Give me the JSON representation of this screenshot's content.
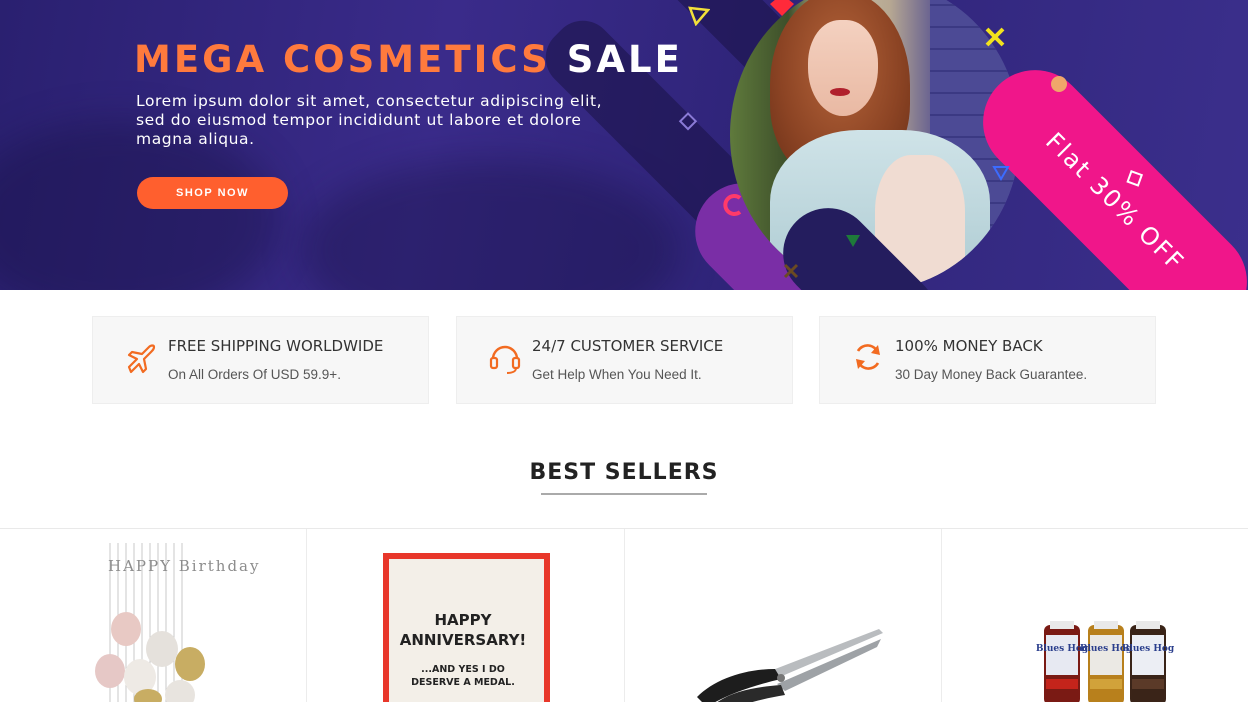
{
  "hero": {
    "title_accent": "MEGA COSMETICS",
    "title_plain": "SALE",
    "description": "Lorem ipsum dolor sit amet, consectetur adipiscing elit, sed do eiusmod tempor incididunt ut labore et dolore magna aliqua.",
    "button_label": "SHOP NOW",
    "promo_text": "Flat 30% OFF",
    "colors": {
      "background": "#2f2479",
      "accent": "#ff7a3d",
      "button": "#ff5f2e",
      "promo": "#f0168a"
    }
  },
  "features": [
    {
      "icon": "airplane-icon",
      "title": "FREE SHIPPING WORLDWIDE",
      "subtitle": "On All Orders Of USD 59.9+."
    },
    {
      "icon": "headset-icon",
      "title": "24/7 CUSTOMER SERVICE",
      "subtitle": "Get Help When You Need It."
    },
    {
      "icon": "refresh-icon",
      "title": "100% MONEY BACK",
      "subtitle": "30 Day Money Back Guarantee."
    }
  ],
  "best_sellers": {
    "title": "BEST SELLERS",
    "products": [
      {
        "image": "birthday-balloons",
        "image_text": "HAPPY Birthday"
      },
      {
        "image": "anniversary-card",
        "image_text_line1": "HAPPY",
        "image_text_line2": "ANNIVERSARY!",
        "image_text_line3": "...AND YES I DO",
        "image_text_line4": "DESERVE A MEDAL."
      },
      {
        "image": "kitchen-shears"
      },
      {
        "image": "bbq-sauce-bottles",
        "image_text": "Blues Hog"
      }
    ]
  }
}
